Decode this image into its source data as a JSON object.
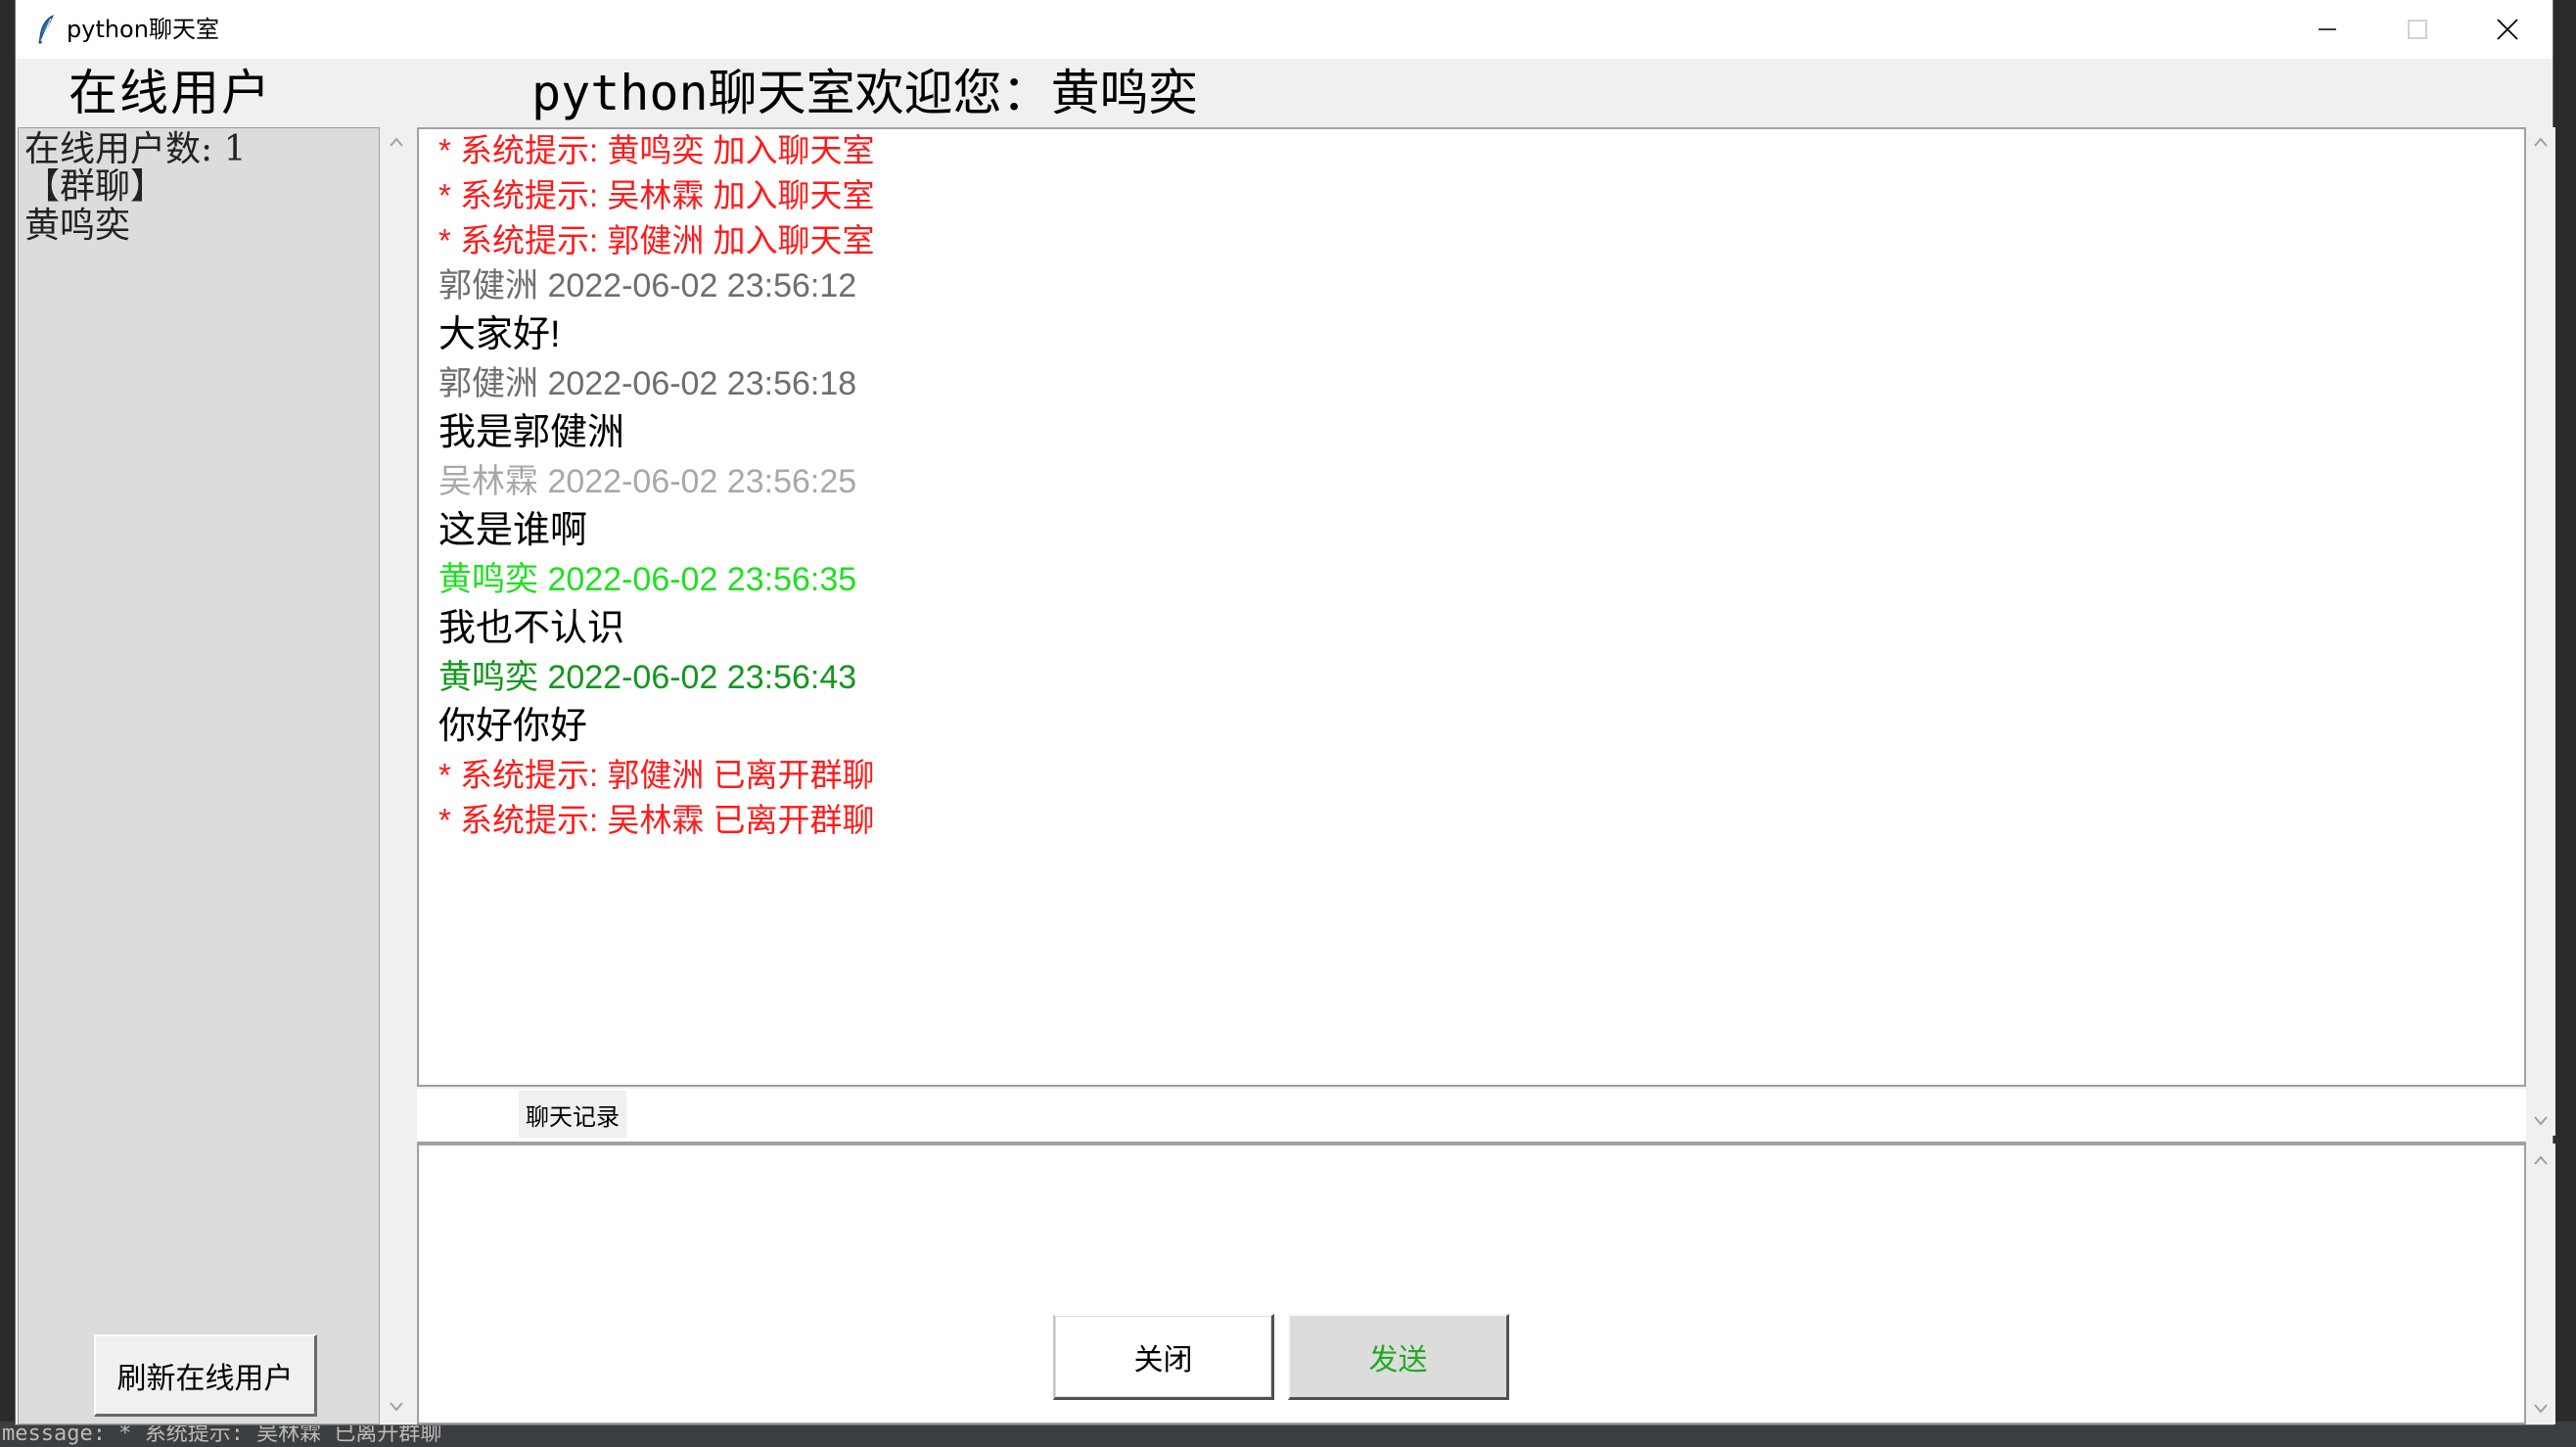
{
  "window": {
    "title": "python聊天室"
  },
  "background": {
    "status_text": "message: * 系统提示: 吴林霖 已离开群聊"
  },
  "headers": {
    "online_users": "在线用户",
    "welcome": "python聊天室欢迎您：黄鸣奕"
  },
  "user_list": {
    "count_line": "在线用户数: 1",
    "items": [
      "【群聊】",
      "黄鸣奕"
    ]
  },
  "buttons": {
    "refresh": "刷新在线用户",
    "history": "聊天记录",
    "close": "关闭",
    "send": "发送"
  },
  "messages": [
    {
      "kind": "system",
      "text": "* 系统提示: 黄鸣奕 加入聊天室"
    },
    {
      "kind": "system",
      "text": "* 系统提示: 吴林霖 加入聊天室"
    },
    {
      "kind": "system",
      "text": "* 系统提示: 郭健洲 加入聊天室"
    },
    {
      "kind": "meta",
      "text": "郭健洲 2022-06-02 23:56:12",
      "color": "#6e6e6e"
    },
    {
      "kind": "body",
      "text": "大家好!"
    },
    {
      "kind": "meta",
      "text": "郭健洲 2022-06-02 23:56:18",
      "color": "#6e6e6e"
    },
    {
      "kind": "body",
      "text": "我是郭健洲"
    },
    {
      "kind": "meta",
      "text": "吴林霖 2022-06-02 23:56:25",
      "color": "#a8a8a8"
    },
    {
      "kind": "body",
      "text": "这是谁啊"
    },
    {
      "kind": "meta",
      "text": "黄鸣奕 2022-06-02 23:56:35",
      "color": "#1fe01f"
    },
    {
      "kind": "body",
      "text": "我也不认识"
    },
    {
      "kind": "meta",
      "text": "黄鸣奕 2022-06-02 23:56:43",
      "color": "#14961e"
    },
    {
      "kind": "body",
      "text": "你好你好"
    },
    {
      "kind": "system",
      "text": "* 系统提示: 郭健洲 已离开群聊"
    },
    {
      "kind": "system",
      "text": "* 系统提示: 吴林霖 已离开群聊"
    }
  ],
  "colors": {
    "system": "#ff1a1a",
    "send_text": "#22aa22"
  },
  "input": {
    "value": ""
  }
}
